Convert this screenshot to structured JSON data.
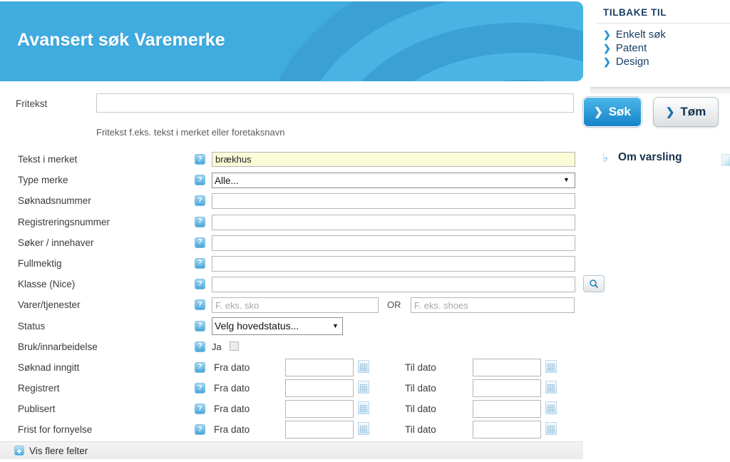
{
  "banner": {
    "title": "Avansert søk Varemerke"
  },
  "sidebar": {
    "heading": "TILBAKE TIL",
    "links": [
      {
        "label": "Enkelt søk"
      },
      {
        "label": "Patent"
      },
      {
        "label": "Design"
      }
    ]
  },
  "buttons": {
    "search": {
      "label": "Søk",
      "chevron": "❯"
    },
    "clear": {
      "label": "Tøm",
      "chevron": "❯"
    }
  },
  "fritekst": {
    "label": "Fritekst",
    "value": "",
    "placeholder": "",
    "hint": "Fritekst f.eks. tekst i merket eller foretaksnavn"
  },
  "varsling": {
    "label": "Om varsling",
    "icon": "bell-icon",
    "bell": "♦"
  },
  "help_icon": {
    "glyph": "?"
  },
  "fields": {
    "tekst_i_merket": {
      "label": "Tekst i merket",
      "value": "brækhus",
      "placeholder": ""
    },
    "type_merke": {
      "label": "Type merke",
      "selected": "Alle...",
      "arrow": "▼"
    },
    "soknadsnummer": {
      "label": "Søknadsnummer",
      "value": "",
      "placeholder": ""
    },
    "registreringsnummer": {
      "label": "Registreringsnummer",
      "value": "",
      "placeholder": ""
    },
    "soker_innehaver": {
      "label": "Søker / innehaver",
      "value": "",
      "placeholder": ""
    },
    "fullmektig": {
      "label": "Fullmektig",
      "value": "",
      "placeholder": ""
    },
    "klasse_nice": {
      "label": "Klasse (Nice)",
      "value": "",
      "placeholder": "",
      "lookup_icon": "magnifier-icon"
    },
    "varer_tjenester": {
      "label": "Varer/tjenester",
      "value_left": "",
      "placeholder_left": "F. eks. sko",
      "separator": "OR",
      "value_right": "",
      "placeholder_right": "F. eks. shoes"
    },
    "status": {
      "label": "Status",
      "selected": "Velg hovedstatus...",
      "arrow": "▼"
    },
    "bruk_innarbeidelse": {
      "label": "Bruk/innarbeidelse",
      "checkbox_label": "Ja",
      "checked": false
    }
  },
  "date_rows": [
    {
      "label": "Søknad inngitt",
      "from_label": "Fra dato",
      "from_value": "",
      "to_label": "Til dato",
      "to_value": ""
    },
    {
      "label": "Registrert",
      "from_label": "Fra dato",
      "from_value": "",
      "to_label": "Til dato",
      "to_value": ""
    },
    {
      "label": "Publisert",
      "from_label": "Fra dato",
      "from_value": "",
      "to_label": "Til dato",
      "to_value": ""
    },
    {
      "label": "Frist for fornyelse",
      "from_label": "Fra dato",
      "from_value": "",
      "to_label": "Til dato",
      "to_value": ""
    }
  ],
  "show_more": {
    "label": "Vis flere felter",
    "icon": "plus-icon"
  },
  "colors": {
    "banner": "#3fabdf",
    "accent": "#1483c9",
    "sidebar_text": "#1b3f63",
    "highlight_field": "#fbfbd8"
  }
}
